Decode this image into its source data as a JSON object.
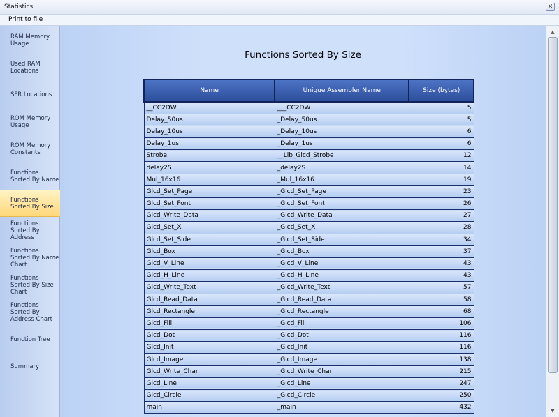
{
  "window": {
    "title": "Statistics",
    "close_icon": "close-icon"
  },
  "menu": {
    "print_first": "P",
    "print_rest": "rint to file"
  },
  "sidebar": {
    "items": [
      {
        "label": "RAM Memory Usage",
        "active": false
      },
      {
        "label": "Used RAM Locations",
        "active": false
      },
      {
        "label": "SFR Locations",
        "active": false
      },
      {
        "label": "ROM Memory Usage",
        "active": false
      },
      {
        "label": "ROM Memory Constants",
        "active": false
      },
      {
        "label": "Functions Sorted By  Name",
        "active": false
      },
      {
        "label": "Functions Sorted By Size",
        "active": true
      },
      {
        "label": "Functions Sorted By Address",
        "active": false
      },
      {
        "label": "Functions Sorted By Name Chart",
        "active": false
      },
      {
        "label": "Functions Sorted By Size Chart",
        "active": false
      },
      {
        "label": "Functions Sorted By Address Chart",
        "active": false
      },
      {
        "label": "Function Tree",
        "active": false
      },
      {
        "label": "Summary",
        "active": false
      }
    ]
  },
  "main": {
    "title": "Functions Sorted By Size",
    "table": {
      "headers": [
        "Name",
        "Unique Assembler Name",
        "Size (bytes)"
      ],
      "rows": [
        [
          "__CC2DW",
          "___CC2DW",
          "5"
        ],
        [
          "Delay_50us",
          "_Delay_50us",
          "5"
        ],
        [
          "Delay_10us",
          "_Delay_10us",
          "6"
        ],
        [
          "Delay_1us",
          "_Delay_1us",
          "6"
        ],
        [
          "Strobe",
          "__Lib_Glcd_Strobe",
          "12"
        ],
        [
          "delay2S",
          "_delay2S",
          "14"
        ],
        [
          "Mul_16x16",
          "_Mul_16x16",
          "19"
        ],
        [
          "Glcd_Set_Page",
          "_Glcd_Set_Page",
          "23"
        ],
        [
          "Glcd_Set_Font",
          "_Glcd_Set_Font",
          "26"
        ],
        [
          "Glcd_Write_Data",
          "_Glcd_Write_Data",
          "27"
        ],
        [
          "Glcd_Set_X",
          "_Glcd_Set_X",
          "28"
        ],
        [
          "Glcd_Set_Side",
          "_Glcd_Set_Side",
          "34"
        ],
        [
          "Glcd_Box",
          "_Glcd_Box",
          "37"
        ],
        [
          "Glcd_V_Line",
          "_Glcd_V_Line",
          "43"
        ],
        [
          "Glcd_H_Line",
          "_Glcd_H_Line",
          "43"
        ],
        [
          "Glcd_Write_Text",
          "_Glcd_Write_Text",
          "57"
        ],
        [
          "Glcd_Read_Data",
          "_Glcd_Read_Data",
          "58"
        ],
        [
          "Glcd_Rectangle",
          "_Glcd_Rectangle",
          "68"
        ],
        [
          "Glcd_Fill",
          "_Glcd_Fill",
          "106"
        ],
        [
          "Glcd_Dot",
          "_Glcd_Dot",
          "116"
        ],
        [
          "Glcd_Init",
          "_Glcd_Init",
          "116"
        ],
        [
          "Glcd_Image",
          "_Glcd_Image",
          "138"
        ],
        [
          "Glcd_Write_Char",
          "_Glcd_Write_Char",
          "215"
        ],
        [
          "Glcd_Line",
          "_Glcd_Line",
          "247"
        ],
        [
          "Glcd_Circle",
          "_Glcd_Circle",
          "250"
        ],
        [
          "main",
          "_main",
          "432"
        ]
      ]
    }
  },
  "scrollbar": {
    "up_icon": "scroll-up-arrow-icon",
    "down_icon": "scroll-down-arrow-icon"
  }
}
